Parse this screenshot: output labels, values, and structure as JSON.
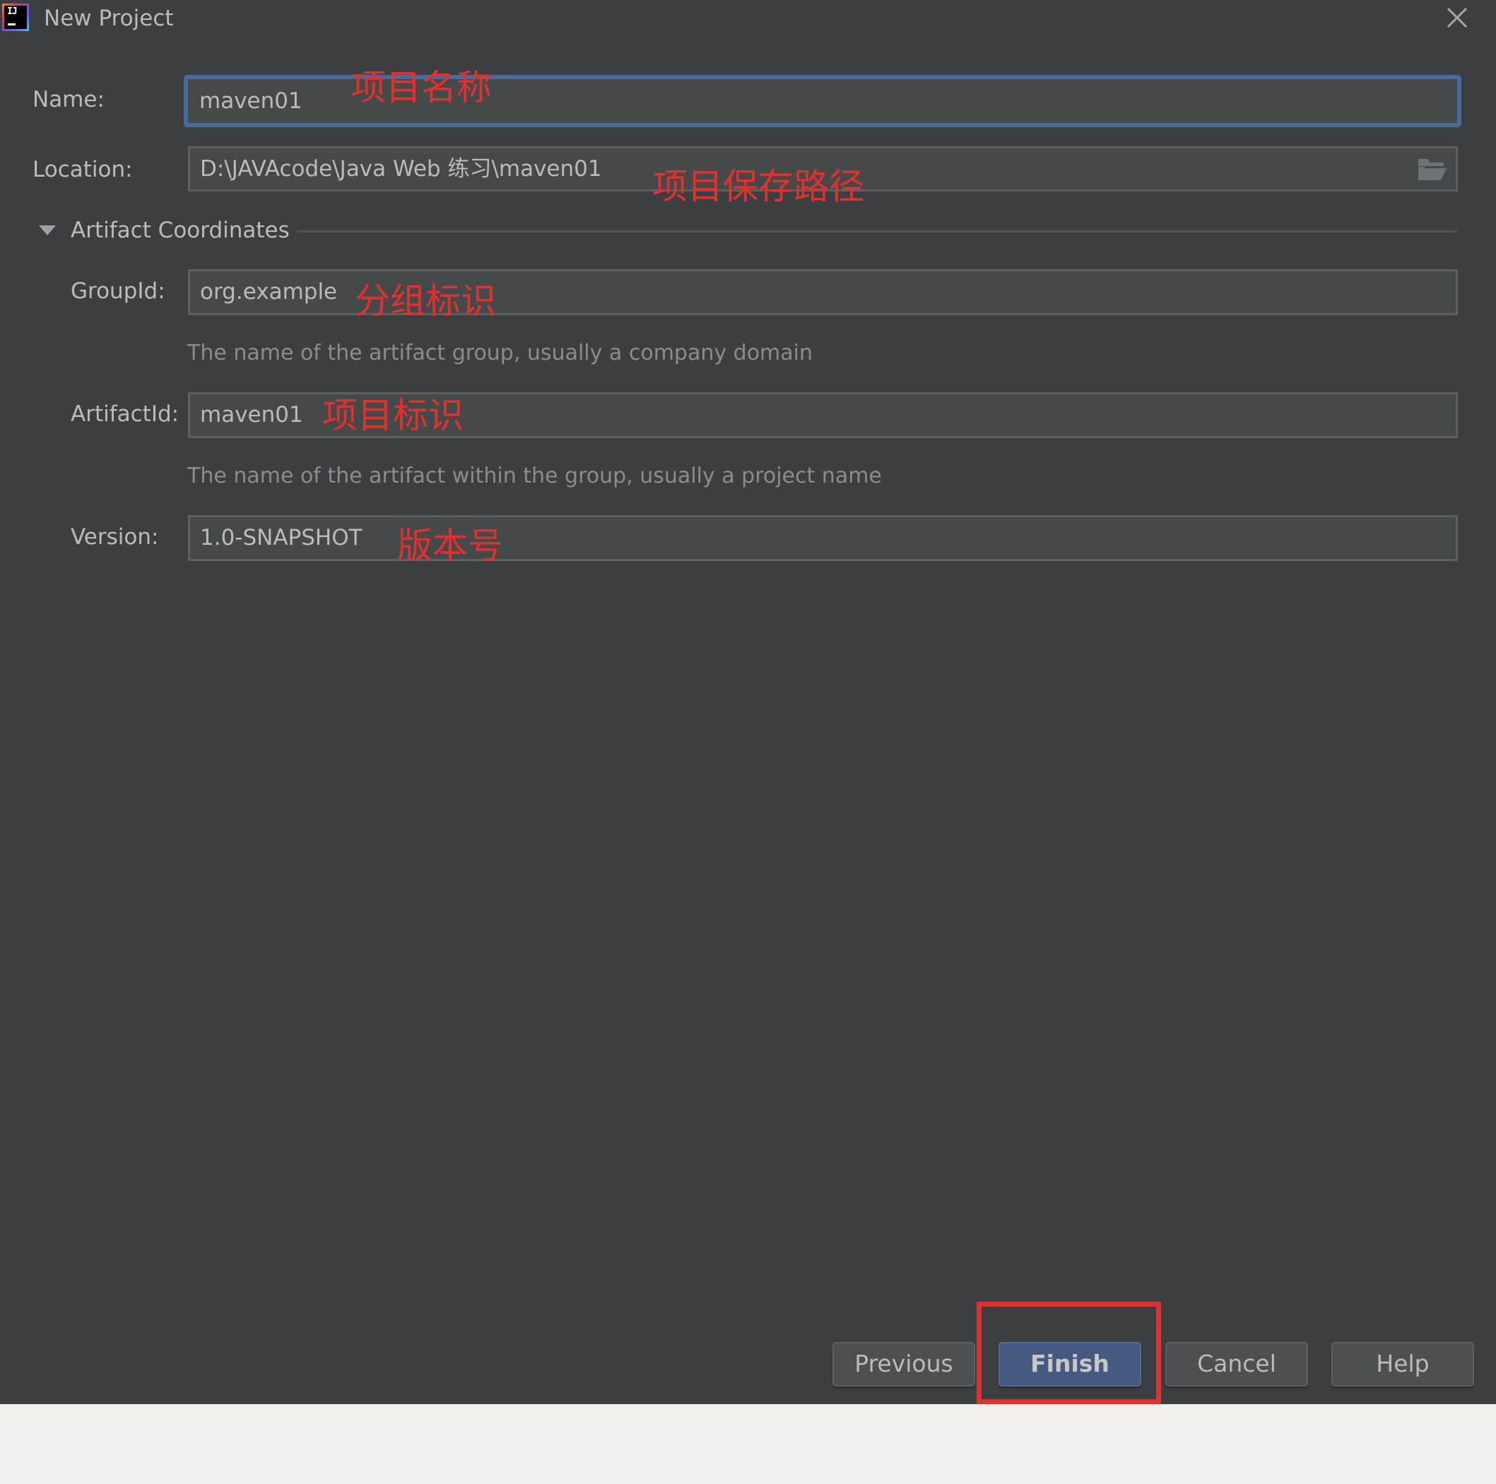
{
  "window": {
    "title": "New Project",
    "app_icon": "intellij-idea-icon",
    "close_icon": "close-icon"
  },
  "form": {
    "name": {
      "label": "Name:",
      "value": "maven01",
      "focused": true
    },
    "location": {
      "label": "Location:",
      "value": "D:\\JAVAcode\\Java  Web 练习\\maven01",
      "browse_icon": "folder-open-icon"
    },
    "artifact_section": {
      "title": "Artifact Coordinates",
      "expanded": true
    },
    "group_id": {
      "label": "GroupId:",
      "value": "org.example",
      "hint": "The name of the artifact group, usually a company domain"
    },
    "artifact_id": {
      "label": "ArtifactId:",
      "value": "maven01",
      "hint": "The name of the artifact within the group, usually a project name"
    },
    "version": {
      "label": "Version:",
      "value": "1.0-SNAPSHOT"
    }
  },
  "annotations": {
    "name": "项目名称",
    "location": "项目保存路径",
    "group_id": "分组标识",
    "artifact_id": "项目标识",
    "version": "版本号",
    "highlight_color": "#d93333"
  },
  "buttons": {
    "previous": "Previous",
    "finish": "Finish",
    "cancel": "Cancel",
    "help": "Help"
  },
  "colors": {
    "background": "#3c3f41",
    "field": "#45494a",
    "focus": "#4a6a9a",
    "primary_button": "#455a80"
  }
}
